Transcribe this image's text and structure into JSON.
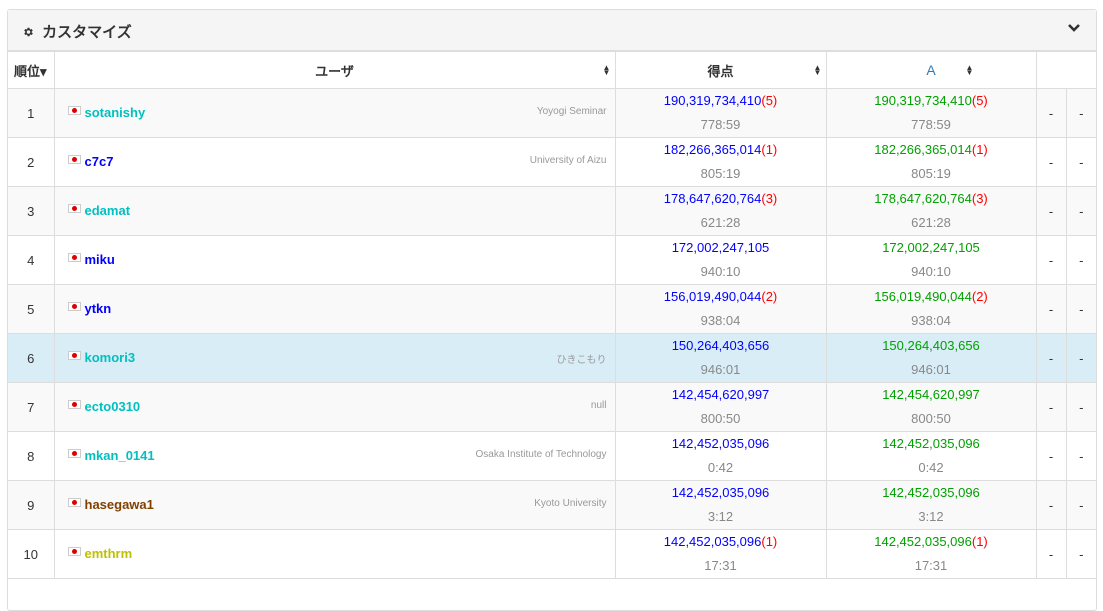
{
  "panel": {
    "title": "カスタマイズ",
    "gear_icon": "gear-icon",
    "collapse_icon": "chevron-down-icon"
  },
  "columns": {
    "rank": "順位",
    "rank_sort_icon": "▾",
    "user": "ユーザ",
    "score": "得点",
    "task_a": "A",
    "sort_icon": "sort-icon"
  },
  "colors": {
    "highlight_row": "#d9edf7",
    "score_total": "#0000ff",
    "score_task": "#00a000",
    "penalty": "#ff0000"
  },
  "rows": [
    {
      "rank": "1",
      "user": "sotanishy",
      "user_color": "c-cyan",
      "aff": "Yoyogi Seminar",
      "score": "190,319,734,410",
      "penalty": "(5)",
      "time": "778:59",
      "a_score": "190,319,734,410",
      "a_penalty": "(5)",
      "a_time": "778:59",
      "d1": "-",
      "d2": "-"
    },
    {
      "rank": "2",
      "user": "c7c7",
      "user_color": "c-blue",
      "aff": "University of Aizu",
      "score": "182,266,365,014",
      "penalty": "(1)",
      "time": "805:19",
      "a_score": "182,266,365,014",
      "a_penalty": "(1)",
      "a_time": "805:19",
      "d1": "-",
      "d2": "-"
    },
    {
      "rank": "3",
      "user": "edamat",
      "user_color": "c-cyan",
      "aff": "",
      "score": "178,647,620,764",
      "penalty": "(3)",
      "time": "621:28",
      "a_score": "178,647,620,764",
      "a_penalty": "(3)",
      "a_time": "621:28",
      "d1": "-",
      "d2": "-"
    },
    {
      "rank": "4",
      "user": "miku",
      "user_color": "c-blue",
      "aff": "",
      "score": "172,002,247,105",
      "penalty": "",
      "time": "940:10",
      "a_score": "172,002,247,105",
      "a_penalty": "",
      "a_time": "940:10",
      "d1": "-",
      "d2": "-"
    },
    {
      "rank": "5",
      "user": "ytkn",
      "user_color": "c-blue",
      "aff": "",
      "score": "156,019,490,044",
      "penalty": "(2)",
      "time": "938:04",
      "a_score": "156,019,490,044",
      "a_penalty": "(2)",
      "a_time": "938:04",
      "d1": "-",
      "d2": "-"
    },
    {
      "rank": "6",
      "user": "komori3",
      "user_color": "c-cyan",
      "aff": "ひきこもり",
      "score": "150,264,403,656",
      "penalty": "",
      "time": "946:01",
      "a_score": "150,264,403,656",
      "a_penalty": "",
      "a_time": "946:01",
      "d1": "-",
      "d2": "-",
      "highlight": true
    },
    {
      "rank": "7",
      "user": "ecto0310",
      "user_color": "c-cyan",
      "aff": "null",
      "score": "142,454,620,997",
      "penalty": "",
      "time": "800:50",
      "a_score": "142,454,620,997",
      "a_penalty": "",
      "a_time": "800:50",
      "d1": "-",
      "d2": "-"
    },
    {
      "rank": "8",
      "user": "mkan_0141",
      "user_color": "c-cyan",
      "aff": "Osaka Institute of Technology",
      "score": "142,452,035,096",
      "penalty": "",
      "time": "0:42",
      "a_score": "142,452,035,096",
      "a_penalty": "",
      "a_time": "0:42",
      "d1": "-",
      "d2": "-"
    },
    {
      "rank": "9",
      "user": "hasegawa1",
      "user_color": "c-brown",
      "aff": "Kyoto University",
      "score": "142,452,035,096",
      "penalty": "",
      "time": "3:12",
      "a_score": "142,452,035,096",
      "a_penalty": "",
      "a_time": "3:12",
      "d1": "-",
      "d2": "-"
    },
    {
      "rank": "10",
      "user": "emthrm",
      "user_color": "c-yellow",
      "aff": "",
      "score": "142,452,035,096",
      "penalty": "(1)",
      "time": "17:31",
      "a_score": "142,452,035,096",
      "a_penalty": "(1)",
      "a_time": "17:31",
      "d1": "-",
      "d2": "-"
    }
  ]
}
